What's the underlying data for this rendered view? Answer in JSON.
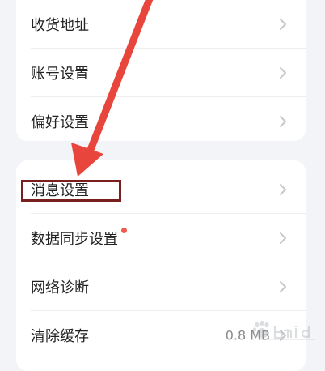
{
  "settings": {
    "group1": [
      {
        "label": "收货地址"
      },
      {
        "label": "账号设置"
      },
      {
        "label": "偏好设置"
      }
    ],
    "group2": [
      {
        "label": "消息设置"
      },
      {
        "label": "数据同步设置"
      },
      {
        "label": "网络诊断"
      },
      {
        "label": "清除缓存",
        "value": "0.8 MB"
      }
    ]
  },
  "icons": {
    "chevron": "chevron-right-icon",
    "notification": "red-dot-badge",
    "annotation_arrow": "red-arrow",
    "watermark": "baidu-logo"
  },
  "colors": {
    "background": "#f3f4f8",
    "card": "#ffffff",
    "text": "#222222",
    "value": "#8a8a8a",
    "chevron": "#c7c7cc",
    "dot": "#f05a4e",
    "arrow": "#e8453c",
    "highlight": "#7a1f1f"
  }
}
